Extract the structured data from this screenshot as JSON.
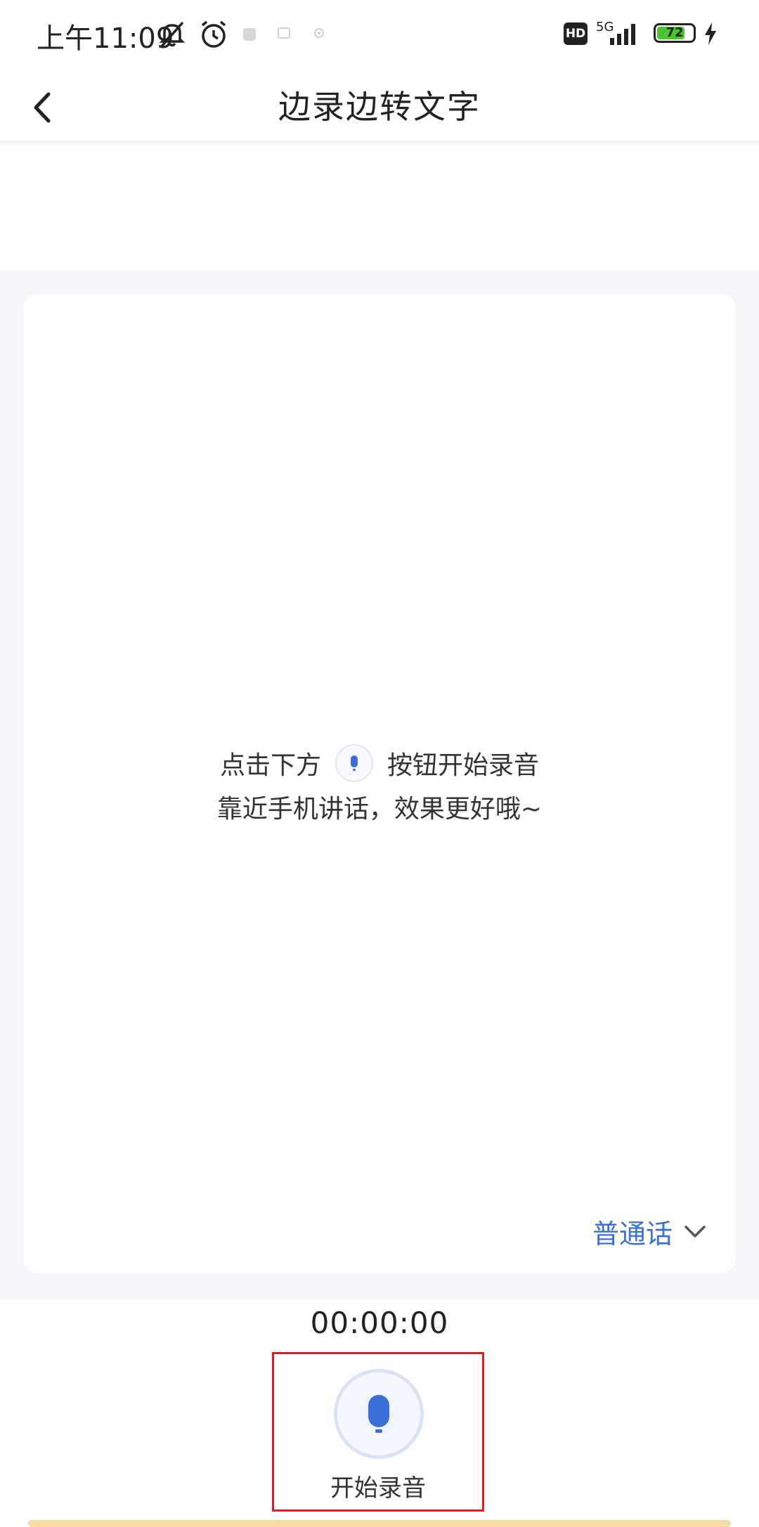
{
  "status_bar": {
    "time": "上午11:09",
    "network": "5G",
    "hd": "HD",
    "battery": "72"
  },
  "header": {
    "title": "边录边转文字"
  },
  "hint": {
    "line1_before": "点击下方",
    "line1_after": "按钮开始录音",
    "line2": "靠近手机讲话，效果更好哦~"
  },
  "language": {
    "selected": "普通话"
  },
  "recorder": {
    "timer": "00:00:00",
    "start_label": "开始录音"
  },
  "colors": {
    "accent": "#3a6fd8",
    "highlight_box": "#e02020",
    "content_bg": "#f5f6fa"
  }
}
